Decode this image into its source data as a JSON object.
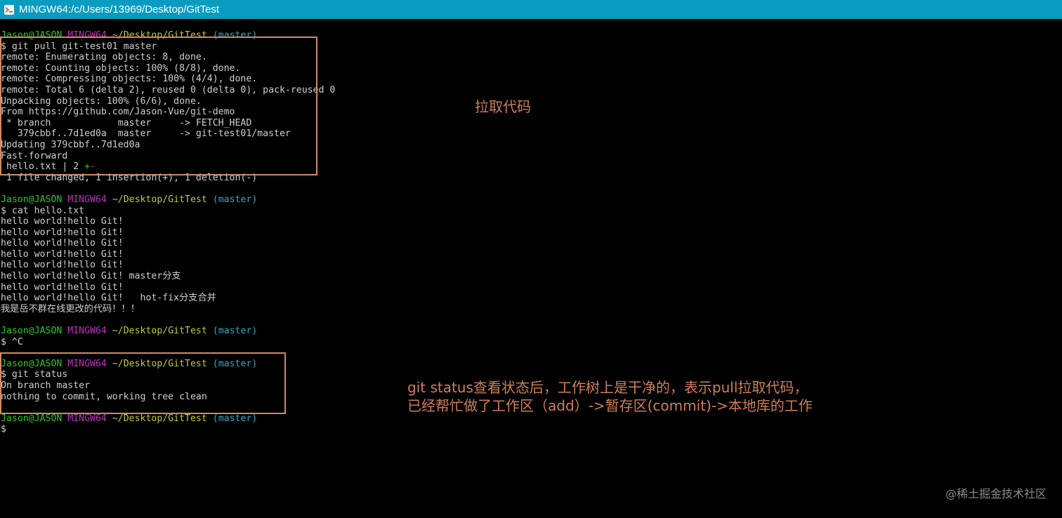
{
  "window": {
    "title": "MINGW64:/c/Users/13969/Desktop/GitTest",
    "icon": "git-bash-icon"
  },
  "colors": {
    "titlebar": "#0a9bc0",
    "user": "#29c729",
    "host_env": "#c030c0",
    "path": "#c8c83c",
    "branch": "#3aa6c2",
    "annotation": "#cf7f58"
  },
  "prompt": {
    "user": "Jason@JASON",
    "env": "MINGW64",
    "path": "~/Desktop/GitTest",
    "branch": "(master)"
  },
  "blocks": [
    {
      "command": "$ git pull git-test01 master",
      "output": [
        "remote: Enumerating objects: 8, done.",
        "remote: Counting objects: 100% (8/8), done.",
        "remote: Compressing objects: 100% (4/4), done.",
        "remote: Total 6 (delta 2), reused 0 (delta 0), pack-reused 0",
        "Unpacking objects: 100% (6/6), done.",
        "From https://github.com/Jason-Vue/git-demo",
        " * branch            master     -> FETCH_HEAD",
        "   379cbbf..7d1ed0a  master     -> git-test01/master",
        "Updating 379cbbf..7d1ed0a",
        "Fast-forward"
      ],
      "diffstat": {
        "file": " hello.txt | 2 ",
        "plus": "+",
        "minus": "-"
      },
      "summary": " 1 file changed, 1 insertion(+), 1 deletion(-)"
    },
    {
      "command": "$ cat hello.txt",
      "output": [
        "hello world!hello Git!",
        "hello world!hello Git!",
        "hello world!hello Git!",
        "hello world!hello Git!",
        "hello world!hello Git!",
        "hello world!hello Git! master分支",
        "hello world!hello Git!",
        "hello world!hello Git!   hot-fix分支合并",
        "我是岳不群在线更改的代码！！！"
      ]
    },
    {
      "command": "$ ^C",
      "output": []
    },
    {
      "command": "$ git status",
      "output": [
        "On branch master",
        "nothing to commit, working tree clean"
      ]
    },
    {
      "command": "$",
      "output": []
    }
  ],
  "annotations": {
    "pull": "拉取代码",
    "status_line1": "git status查看状态后，工作树上是干净的，表示pull拉取代码，",
    "status_line2": "已经帮忙做了工作区（add）->暂存区(commit)->本地库的工作"
  },
  "watermark": "@稀土掘金技术社区"
}
